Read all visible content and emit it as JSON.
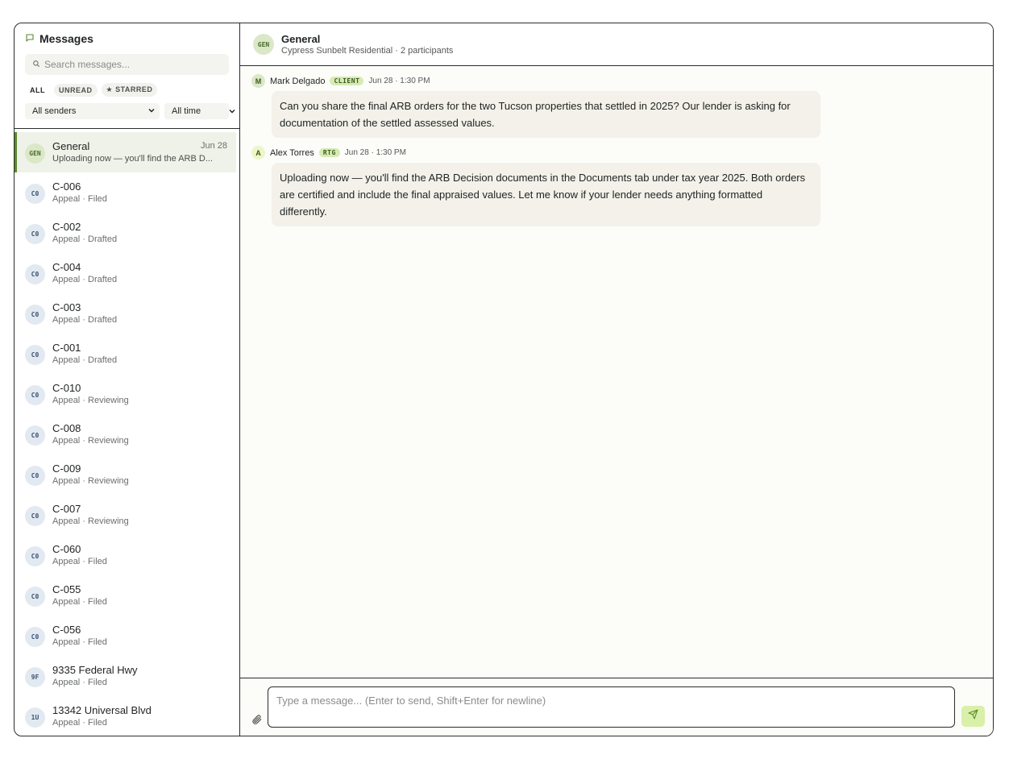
{
  "sidebar": {
    "title": "Messages",
    "search_placeholder": "Search messages...",
    "tabs": [
      {
        "label": "ALL"
      },
      {
        "label": "UNREAD"
      },
      {
        "label": "★ STARRED"
      }
    ],
    "sender_filter": "All senders",
    "time_filter": "All time",
    "conversations": [
      {
        "initials": "GEN",
        "name": "General",
        "date": "Jun 28",
        "sub": "Uploading now — you'll find the ARB D..."
      },
      {
        "initials": "C0",
        "name": "C-006",
        "date": "",
        "sub": "Appeal · Filed"
      },
      {
        "initials": "C0",
        "name": "C-002",
        "date": "",
        "sub": "Appeal · Drafted"
      },
      {
        "initials": "C0",
        "name": "C-004",
        "date": "",
        "sub": "Appeal · Drafted"
      },
      {
        "initials": "C0",
        "name": "C-003",
        "date": "",
        "sub": "Appeal · Drafted"
      },
      {
        "initials": "C0",
        "name": "C-001",
        "date": "",
        "sub": "Appeal · Drafted"
      },
      {
        "initials": "C0",
        "name": "C-010",
        "date": "",
        "sub": "Appeal · Reviewing"
      },
      {
        "initials": "C0",
        "name": "C-008",
        "date": "",
        "sub": "Appeal · Reviewing"
      },
      {
        "initials": "C0",
        "name": "C-009",
        "date": "",
        "sub": "Appeal · Reviewing"
      },
      {
        "initials": "C0",
        "name": "C-007",
        "date": "",
        "sub": "Appeal · Reviewing"
      },
      {
        "initials": "C0",
        "name": "C-060",
        "date": "",
        "sub": "Appeal · Filed"
      },
      {
        "initials": "C0",
        "name": "C-055",
        "date": "",
        "sub": "Appeal · Filed"
      },
      {
        "initials": "C0",
        "name": "C-056",
        "date": "",
        "sub": "Appeal · Filed"
      },
      {
        "initials": "9F",
        "name": "9335 Federal Hwy",
        "date": "",
        "sub": "Appeal · Filed"
      },
      {
        "initials": "1U",
        "name": "13342 Universal Blvd",
        "date": "",
        "sub": "Appeal · Filed"
      }
    ]
  },
  "chat": {
    "avatar": "GEN",
    "title": "General",
    "subtitle": "Cypress Sunbelt Residential · 2 participants",
    "messages": [
      {
        "initial": "M",
        "sender": "Mark Delgado",
        "badge": "CLIENT",
        "time": "Jun 28 · 1:30 PM",
        "text": "Can you share the final ARB orders for the two Tucson properties that settled in 2025? Our lender is asking for documentation of the settled assessed values."
      },
      {
        "initial": "A",
        "sender": "Alex Torres",
        "badge": "RTG",
        "time": "Jun 28 · 1:30 PM",
        "text": "Uploading now — you'll find the ARB Decision documents in the Documents tab under tax year 2025. Both orders are certified and include the final appraised values. Let me know if your lender needs anything formatted differently."
      }
    ],
    "composer_placeholder": "Type a message... (Enter to send, Shift+Enter for newline)"
  },
  "icons": {
    "title_icon": "message-square-icon",
    "search_icon": "search-icon",
    "chevron": "chevron-down-icon",
    "attach": "paperclip-icon",
    "send": "send-icon"
  },
  "colors": {
    "accent": "#5a8a2a",
    "send_bg": "#d8f0a8",
    "bubble_bg": "#f3f1ea",
    "badge_bg": "#d6ebb4"
  }
}
